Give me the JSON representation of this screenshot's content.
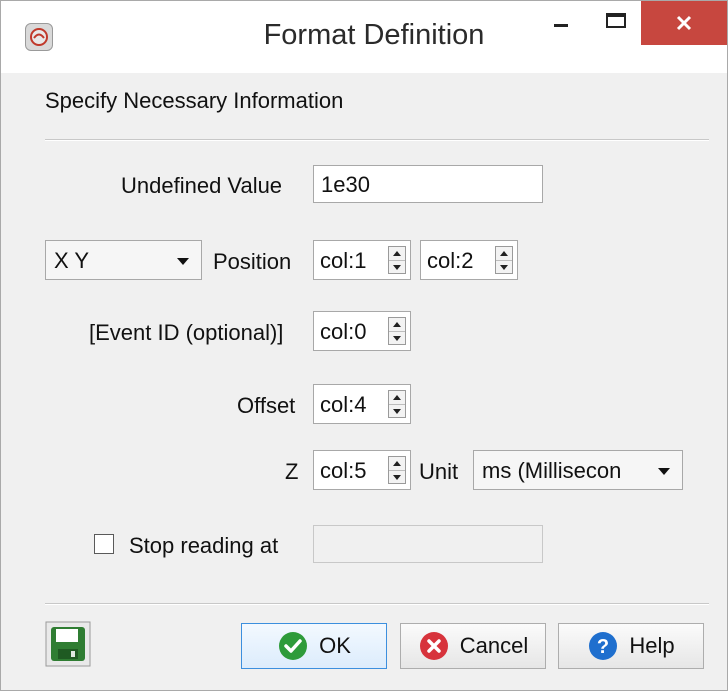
{
  "window": {
    "title": "Format Definition",
    "minimize_icon": "minimize-icon",
    "maximize_icon": "maximize-icon",
    "close_icon": "close-icon",
    "close_color": "#c7473f"
  },
  "form": {
    "subtitle": "Specify Necessary Information",
    "undefined_value": {
      "label": "Undefined Value",
      "value": "1e30"
    },
    "position": {
      "type_options_selected": "X Y",
      "label": "Position",
      "col_x": "col:1",
      "col_y": "col:2"
    },
    "event_id": {
      "label": "[Event ID (optional)]",
      "value": "col:0"
    },
    "offset": {
      "label": "Offset",
      "value": "col:4"
    },
    "z": {
      "label": "Z",
      "value": "col:5",
      "unit_label": "Unit",
      "unit_selected": "ms (Millisecon"
    },
    "stop_reading": {
      "label": "Stop reading at",
      "checked": false,
      "value": ""
    }
  },
  "buttons": {
    "ok": "OK",
    "cancel": "Cancel",
    "help": "Help",
    "save_icon": "save-icon"
  },
  "colors": {
    "accent": "#3c8fde",
    "ok_green": "#2e9b3a",
    "cancel_red": "#d7333c",
    "help_blue": "#1f6fce",
    "save_green": "#2f7d32"
  }
}
